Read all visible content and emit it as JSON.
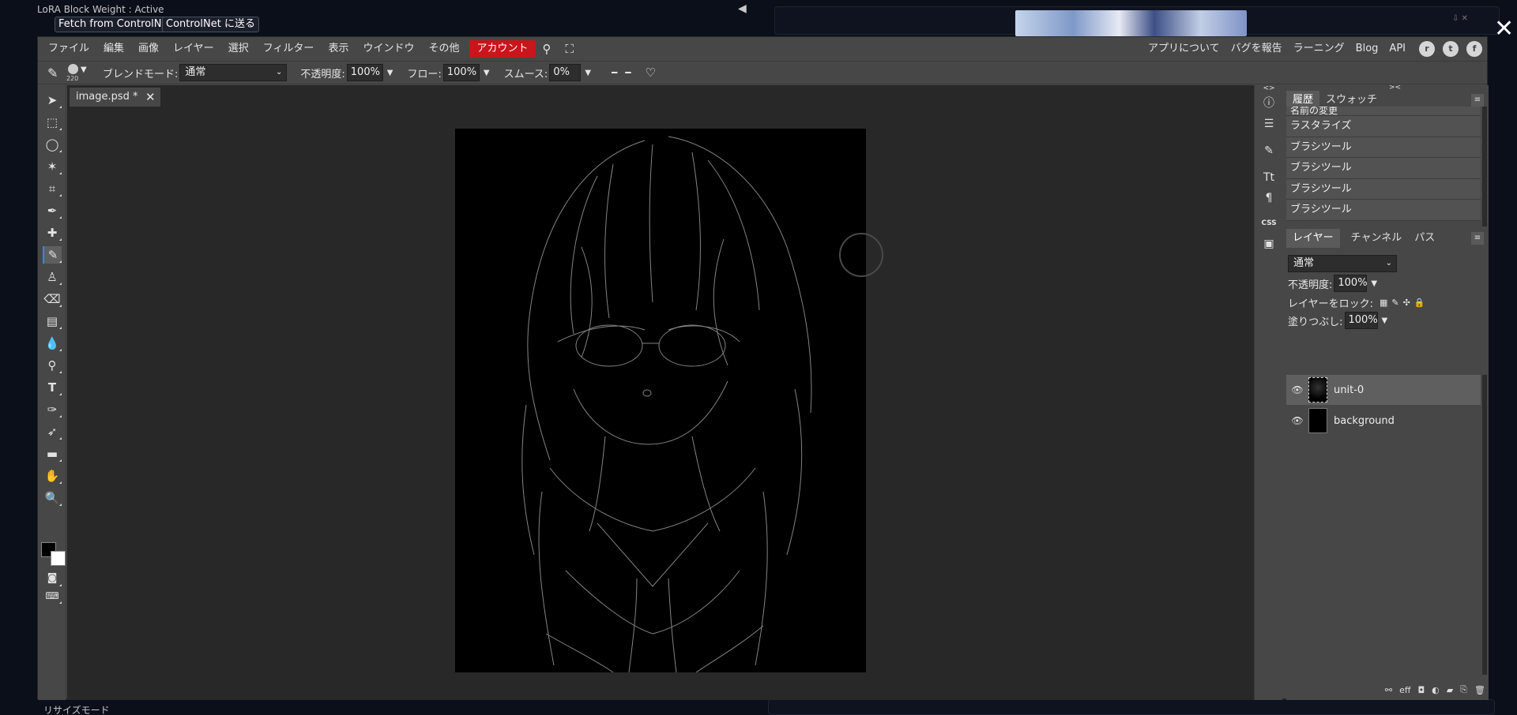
{
  "background": {
    "extension_title": "LoRA Block Weight : Active",
    "fetch_button": "Fetch from ControlNet",
    "send_button": "ControlNet に送る",
    "footer_text": "リサイズモード"
  },
  "menu": {
    "items": [
      "ファイル",
      "編集",
      "画像",
      "レイヤー",
      "選択",
      "フィルター",
      "表示",
      "ウインドウ",
      "その他"
    ],
    "account": "アカウント",
    "right_items": [
      "アプリについて",
      "バグを報告",
      "ラーニング",
      "Blog",
      "API"
    ],
    "social": [
      "reddit-icon",
      "twitter-icon",
      "facebook-icon"
    ]
  },
  "options": {
    "brush_size": "220",
    "blend_label": "ブレンドモード:",
    "blend_value": "通常",
    "opacity_label": "不透明度:",
    "opacity_value": "100%",
    "flow_label": "フロー:",
    "flow_value": "100%",
    "smooth_label": "スムース:",
    "smooth_value": "0%"
  },
  "document_tab": "image.psd *",
  "panels": {
    "history_tab": "履歴",
    "swatches_tab": "スウォッチ",
    "history": [
      "名前の変更",
      "ラスタライズ",
      "ブラシツール",
      "ブラシツール",
      "ブラシツール",
      "ブラシツール"
    ],
    "layers_tab": "レイヤー",
    "channels_tab": "チャンネル",
    "paths_tab": "パス",
    "blend_mode": "通常",
    "opacity_label": "不透明度:",
    "opacity_value": "100%",
    "lock_label": "レイヤーをロック:",
    "fill_label": "塗りつぶし:",
    "fill_value": "100%",
    "layers": [
      "unit-0",
      "background"
    ],
    "bottom_icons": [
      "link-icon",
      "eff",
      "mask-icon",
      "adjust-icon",
      "folder-icon",
      "new-layer-icon",
      "trash-icon"
    ]
  },
  "colors": {
    "accent_account": "#c9151b",
    "foreground": "#000000",
    "background": "#ffffff"
  }
}
